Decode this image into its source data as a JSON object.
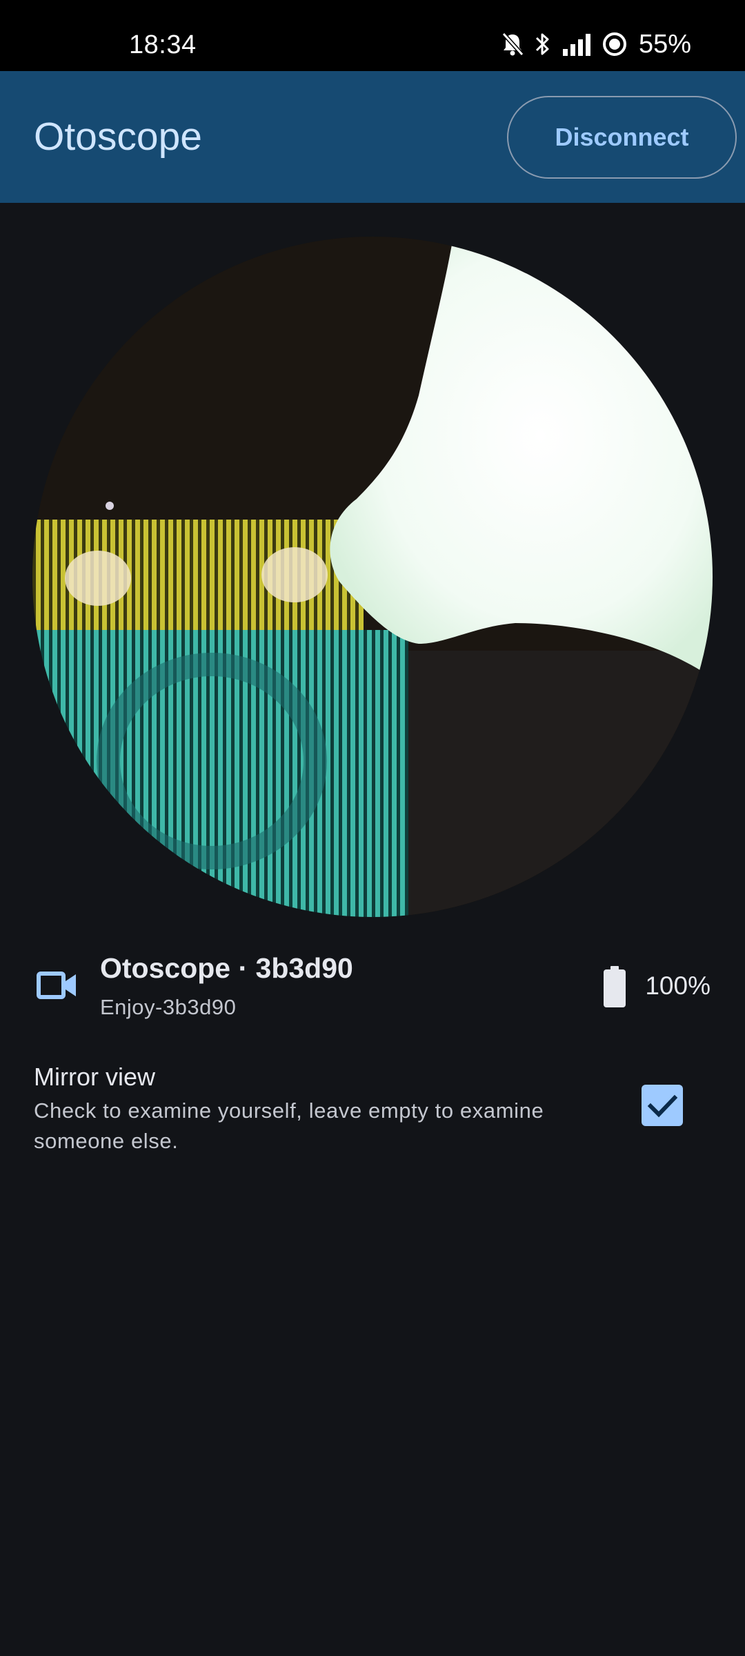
{
  "status_bar": {
    "time": "18:34",
    "battery": "55%",
    "icons": [
      "bell-off-icon",
      "bluetooth-icon",
      "signal-icon",
      "data-saver-icon"
    ]
  },
  "app_bar": {
    "title": "Otoscope",
    "disconnect_label": "Disconnect"
  },
  "device": {
    "icon": "videocam-icon",
    "name": "Otoscope · 3b3d90",
    "ssid": "Enjoy-3b3d90",
    "battery_icon": "battery-full-icon",
    "battery": "100%"
  },
  "mirror": {
    "title": "Mirror view",
    "description": "Check to examine yourself, leave empty to examine someone else.",
    "checked": true
  },
  "colors": {
    "app_bar": "#164a72",
    "background": "#121418",
    "accent": "#9ecaff",
    "title_text": "#cfe5ff"
  }
}
